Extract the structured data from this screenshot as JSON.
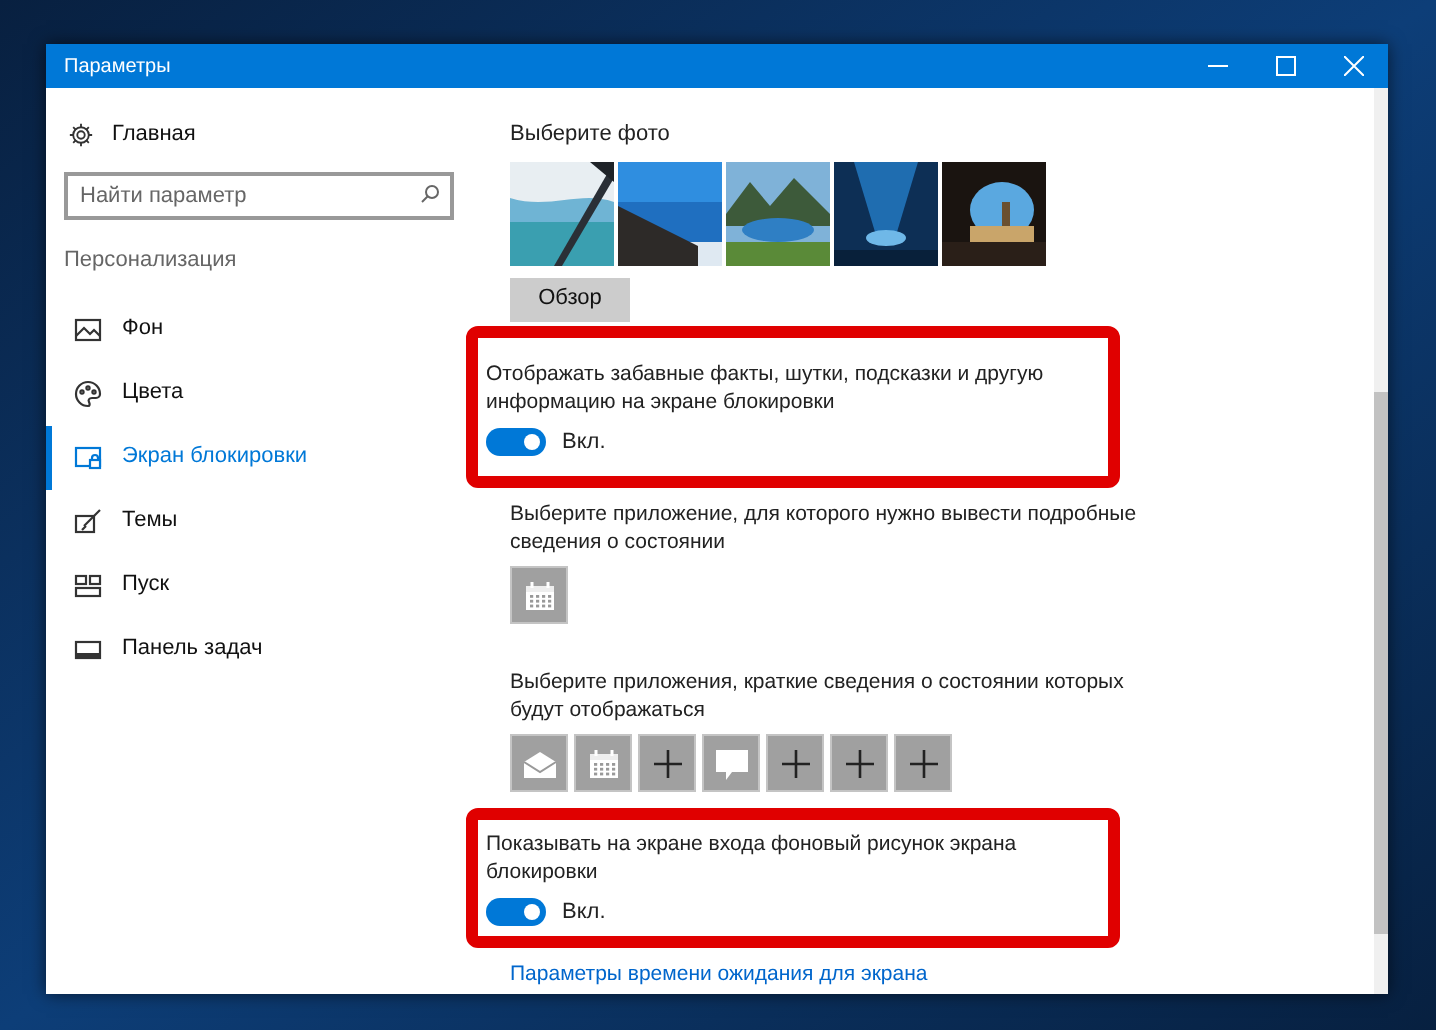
{
  "window": {
    "title": "Параметры"
  },
  "sidebar": {
    "home": "Главная",
    "search": {
      "placeholder": "Найти параметр"
    },
    "section": "Персонализация",
    "items": [
      {
        "label": "Фон",
        "selected": false
      },
      {
        "label": "Цвета",
        "selected": false
      },
      {
        "label": "Экран блокировки",
        "selected": true
      },
      {
        "label": "Темы",
        "selected": false
      },
      {
        "label": "Пуск",
        "selected": false
      },
      {
        "label": "Панель задач",
        "selected": false
      }
    ]
  },
  "content": {
    "photos_label": "Выберите фото",
    "browse_button": "Обзор",
    "fun_facts": {
      "label": "Отображать забавные факты, шутки, подсказки и другую информацию на экране блокировки",
      "on": true,
      "state_label": "Вкл.",
      "highlighted": true
    },
    "detailed_label": "Выберите приложение, для которого нужно вывести подробные сведения о состоянии",
    "detailed_apps": [
      {
        "kind": "calendar"
      }
    ],
    "quick_label": "Выберите приложения, краткие сведения о состоянии которых будут отображаться",
    "quick_apps": [
      {
        "kind": "mail"
      },
      {
        "kind": "calendar"
      },
      {
        "kind": "plus"
      },
      {
        "kind": "chat"
      },
      {
        "kind": "plus"
      },
      {
        "kind": "plus"
      },
      {
        "kind": "plus"
      }
    ],
    "signin_background": {
      "label": "Показывать на экране входа фоновый рисунок экрана блокировки",
      "on": true,
      "state_label": "Вкл.",
      "highlighted": true
    },
    "timeout_link": "Параметры времени ожидания для экрана"
  }
}
